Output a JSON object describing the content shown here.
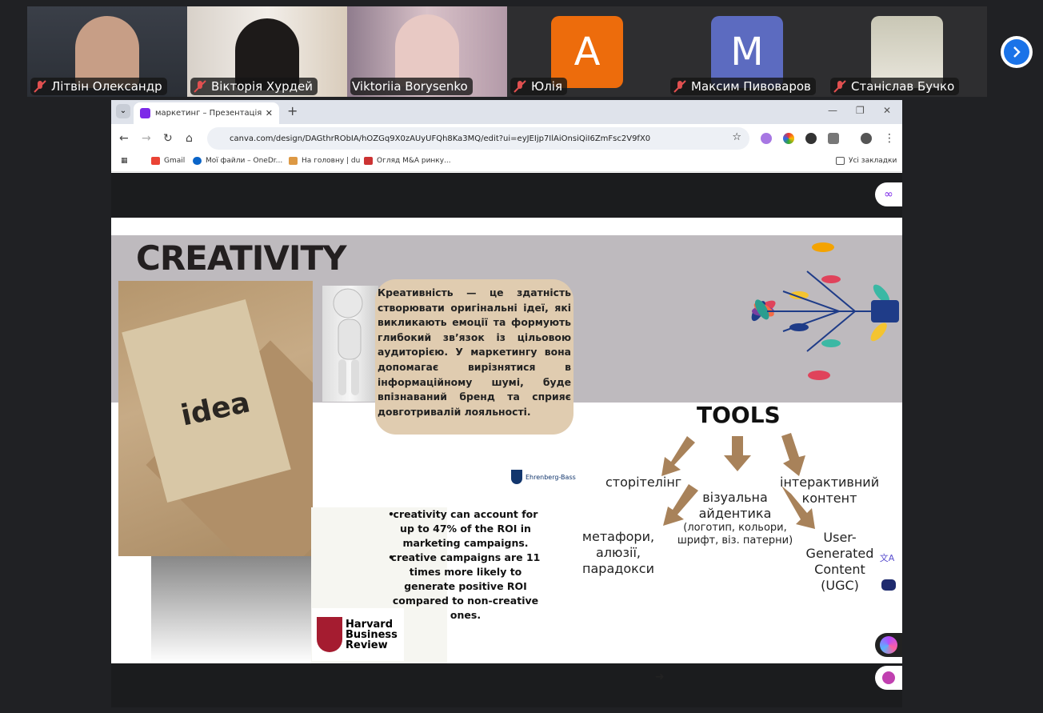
{
  "participants": [
    {
      "name": "Літвін Олександр",
      "muted": true,
      "type": "video"
    },
    {
      "name": "Вікторія Хурдей",
      "muted": true,
      "type": "video"
    },
    {
      "name": "Viktoriia Borysenko",
      "muted": false,
      "type": "video",
      "active": true
    },
    {
      "name": "Юлія",
      "muted": true,
      "type": "avatar",
      "initial": "A",
      "color": "#ed6c0c"
    },
    {
      "name": "Максим Пивоваров",
      "muted": true,
      "type": "avatar",
      "initial": "M",
      "color": "#5c6bc0"
    },
    {
      "name": "Станіслав Бучко",
      "muted": true,
      "type": "avatar",
      "initial": "",
      "color": "#c9c7b5"
    }
  ],
  "browser": {
    "tab_title": "маркетинг – Презентація",
    "url": "canva.com/design/DAGthrRObIA/hOZGq9X0zAUyUFQh8Ka3MQ/edit?ui=eyJEIjp7IlAiOnsiQiI6ZmFsc2V9fX0",
    "bookmarks": [
      "Gmail",
      "Мої файли – OneDr...",
      "На головну | du",
      "Огляд M&A ринку..."
    ],
    "all_bookmarks": "Усі закладки"
  },
  "slide": {
    "title": "CREATIVITY",
    "idea_word": "idea",
    "definition": "Креативність — це здатність створювати оригінальні ідеї, які викликають емоції та формують глибокий зв’язок із цільовою аудиторією. У маркетингу вона допомагає вирізнятися в інформаційному шумі, буде впізнаваний бренд та сприяє довготривалій лояльності.",
    "tools_title": "TOOLS",
    "tools": {
      "storytelling": "сторітелінг",
      "visual_l1": "візуальна",
      "visual_l2": "айдентика",
      "visual_sub1": "(логотип, кольори,",
      "visual_sub2": "шрифт, віз. патерни)",
      "interactive_l1": "інтерактивний",
      "interactive_l2": "контент",
      "metaphor_l1": "метафори,",
      "metaphor_l2": "алюзії,",
      "metaphor_l3": "парадокси",
      "ugc_l1": "User-",
      "ugc_l2": "Generated",
      "ugc_l3": "Content",
      "ugc_l4": "(UGC)"
    },
    "bullets": [
      "creativity can account for up to 47% of the ROI in marketing campaigns.",
      "creative campaigns are 11 times more likely to generate positive ROI compared to non-creative ones."
    ],
    "ehrenberg": "Ehrenberg-Bass",
    "hbr": "Harvard\nBusiness\nReview"
  },
  "colors": {
    "accent_green": "#2ee07a",
    "arrow": "#a8825a",
    "bubble": "#e0ccb0",
    "slide_band": "#bebabe"
  }
}
